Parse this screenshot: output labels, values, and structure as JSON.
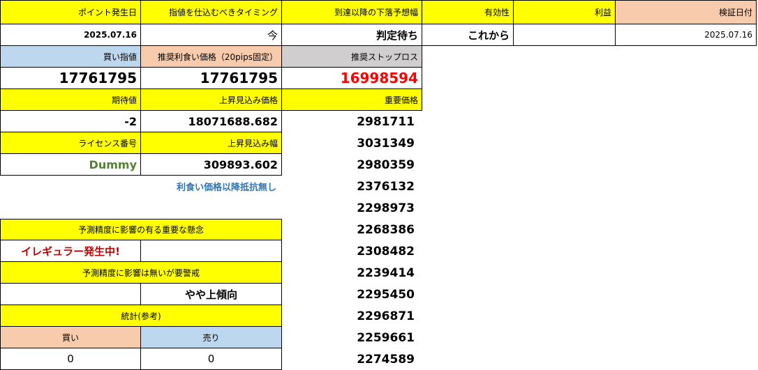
{
  "header": {
    "point_date_label": "ポイント発生日",
    "timing_label": "指値を仕込むべきタイミング",
    "fall_label": "到達以降の下落予想幅",
    "validity_label": "有効性",
    "profit_label": "利益",
    "verify_date_label": "検証日付"
  },
  "row1": {
    "point_date": "2025.07.16",
    "timing": "今",
    "fall": "判定待ち",
    "validity": "これから",
    "profit": "",
    "verify_date": "2025.07.16"
  },
  "prices": {
    "buy_label": "買い指値",
    "take_profit_label": "推奨利食い価格（20pips固定）",
    "stop_label": "推奨ストップロス",
    "buy": "17761795",
    "take_profit": "17761795",
    "stop": "16998594"
  },
  "expect": {
    "expected_label": "期待値",
    "rise_price_label": "上昇見込み価格",
    "key_price_label": "重要価格",
    "expected": "-2",
    "rise_price": "18071688.682"
  },
  "license": {
    "license_label": "ライセンス番号",
    "rise_width_label": "上昇見込み幅",
    "license": "Dummy",
    "rise_width": "309893.602"
  },
  "note": "利食い価格以降抵抗無し",
  "concern": {
    "label": "予測精度に影響の有る重要な懸念",
    "value": "イレギュラー発生中!",
    "value2": ""
  },
  "caution": {
    "label": "予測精度に影響は無いが要警戒",
    "value": "",
    "value2": "やや上傾向"
  },
  "stats": {
    "label": "統計(参考)",
    "buy_label": "買い",
    "sell_label": "売り",
    "buy": "0",
    "sell": "0"
  },
  "key_prices": [
    "2981711",
    "3031349",
    "2980359",
    "2376132",
    "2298973",
    "2268386",
    "2308482",
    "2239414",
    "2295450",
    "2296871",
    "2259661",
    "2274589"
  ],
  "colors": {
    "yellow": "#ffff00",
    "blue": "#bdd7ee",
    "pink": "#f8cbad",
    "gray": "#d0cece",
    "red": "#ff0000",
    "green": "#548235",
    "note_blue": "#2f75b5"
  }
}
